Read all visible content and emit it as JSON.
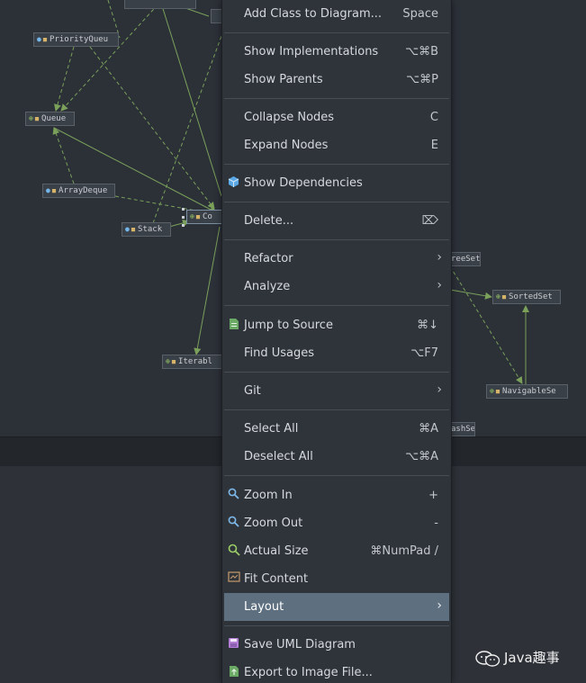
{
  "diagram": {
    "nodes": {
      "priority_queue": "PriorityQueu",
      "queue": "Queue",
      "array_deque": "ArrayDeque",
      "stack": "Stack",
      "collection": "Co",
      "iterable": "Iterabl",
      "tree_set": "reeSet",
      "sorted_set": "SortedSet",
      "navigable_set": "NavigableSe",
      "hash_set": "ashSe"
    }
  },
  "menu": {
    "add_class": {
      "label": "Add Class to Diagram...",
      "shortcut": "Space"
    },
    "show_implementations": {
      "label": "Show Implementations",
      "shortcut": "⌥⌘B"
    },
    "show_parents": {
      "label": "Show Parents",
      "shortcut": "⌥⌘P"
    },
    "collapse_nodes": {
      "label": "Collapse Nodes",
      "shortcut": "C"
    },
    "expand_nodes": {
      "label": "Expand Nodes",
      "shortcut": "E"
    },
    "show_dependencies": {
      "label": "Show Dependencies",
      "icon": "cube-icon"
    },
    "delete": {
      "label": "Delete...",
      "shortcut": "⌦"
    },
    "refactor": {
      "label": "Refactor"
    },
    "analyze": {
      "label": "Analyze"
    },
    "jump_to_source": {
      "label": "Jump to Source",
      "shortcut": "⌘↓",
      "icon": "source-file-icon"
    },
    "find_usages": {
      "label": "Find Usages",
      "shortcut": "⌥F7"
    },
    "git": {
      "label": "Git"
    },
    "select_all": {
      "label": "Select All",
      "shortcut": "⌘A"
    },
    "deselect_all": {
      "label": "Deselect All",
      "shortcut": "⌥⌘A"
    },
    "zoom_in": {
      "label": "Zoom In",
      "shortcut": "+",
      "icon": "zoom-in-icon"
    },
    "zoom_out": {
      "label": "Zoom Out",
      "shortcut": "-",
      "icon": "zoom-out-icon"
    },
    "actual_size": {
      "label": "Actual Size",
      "shortcut": "⌘NumPad /",
      "icon": "actual-size-icon"
    },
    "fit_content": {
      "label": "Fit Content",
      "icon": "fit-content-icon"
    },
    "layout": {
      "label": "Layout"
    },
    "save_uml": {
      "label": "Save UML Diagram",
      "icon": "save-icon"
    },
    "export_image": {
      "label": "Export to Image File...",
      "icon": "export-icon"
    }
  },
  "watermark": {
    "text": "Java趣事"
  },
  "colors": {
    "menu_bg": "#2f343b",
    "highlight": "#5e7080",
    "diagram_bg": "#2c3138",
    "edge": "#7aa05a"
  }
}
